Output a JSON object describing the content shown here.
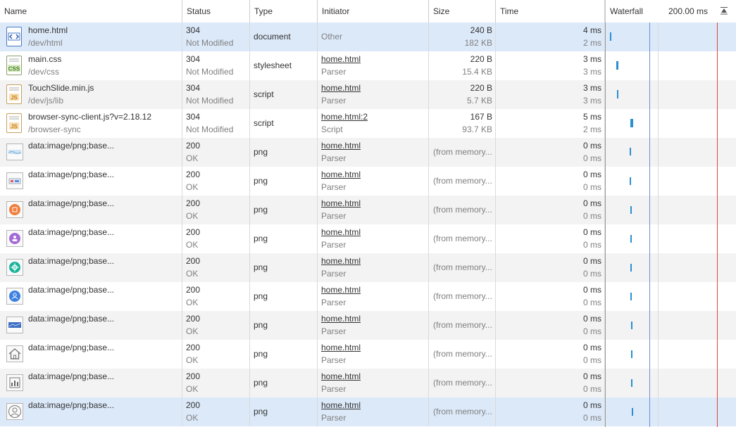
{
  "header": {
    "name": "Name",
    "status": "Status",
    "type": "Type",
    "initiator": "Initiator",
    "size": "Size",
    "time": "Time",
    "waterfall": "Waterfall",
    "waterfall_time": "200.00 ms"
  },
  "colors": {
    "selected_row": "#dce9f9",
    "alt_row": "#f3f3f3",
    "waterfall_bar": "#2a8fd0",
    "dom_content_line": "#6f8ecf",
    "load_line": "#e0443e"
  },
  "rows": [
    {
      "name": "home.html",
      "path": "/dev/html",
      "status": "304",
      "status_text": "Not Modified",
      "type": "document",
      "initiator": "Other",
      "initiator_sub": "",
      "size": "240 B",
      "size2": "182 KB",
      "time": "4 ms",
      "time2": "2 ms",
      "icon": "html-file-icon"
    },
    {
      "name": "main.css",
      "path": "/dev/css",
      "status": "304",
      "status_text": "Not Modified",
      "type": "stylesheet",
      "initiator": "home.html",
      "initiator_sub": "Parser",
      "size": "220 B",
      "size2": "15.4 KB",
      "time": "3 ms",
      "time2": "3 ms",
      "icon": "css-file-icon"
    },
    {
      "name": "TouchSlide.min.js",
      "path": "/dev/js/lib",
      "status": "304",
      "status_text": "Not Modified",
      "type": "script",
      "initiator": "home.html",
      "initiator_sub": "Parser",
      "size": "220 B",
      "size2": "5.7 KB",
      "time": "3 ms",
      "time2": "3 ms",
      "icon": "js-file-icon"
    },
    {
      "name": "browser-sync-client.js?v=2.18.12",
      "path": "/browser-sync",
      "status": "304",
      "status_text": "Not Modified",
      "type": "script",
      "initiator": "home.html:2",
      "initiator_sub": "Script",
      "size": "167 B",
      "size2": "93.7 KB",
      "time": "5 ms",
      "time2": "2 ms",
      "icon": "js-file-icon"
    },
    {
      "name": "data:image/png;base...",
      "path": "",
      "status": "200",
      "status_text": "OK",
      "type": "png",
      "initiator": "home.html",
      "initiator_sub": "Parser",
      "size": "(from memory...",
      "size2": "",
      "time": "0 ms",
      "time2": "0 ms",
      "icon": "banner-image-icon"
    },
    {
      "name": "data:image/png;base...",
      "path": "",
      "status": "200",
      "status_text": "OK",
      "type": "png",
      "initiator": "home.html",
      "initiator_sub": "Parser",
      "size": "(from memory...",
      "size2": "",
      "time": "0 ms",
      "time2": "0 ms",
      "icon": "card-image-icon"
    },
    {
      "name": "data:image/png;base...",
      "path": "",
      "status": "200",
      "status_text": "OK",
      "type": "png",
      "initiator": "home.html",
      "initiator_sub": "Parser",
      "size": "(from memory...",
      "size2": "",
      "time": "0 ms",
      "time2": "0 ms",
      "icon": "orange-circle-icon"
    },
    {
      "name": "data:image/png;base...",
      "path": "",
      "status": "200",
      "status_text": "OK",
      "type": "png",
      "initiator": "home.html",
      "initiator_sub": "Parser",
      "size": "(from memory...",
      "size2": "",
      "time": "0 ms",
      "time2": "0 ms",
      "icon": "purple-circle-icon"
    },
    {
      "name": "data:image/png;base...",
      "path": "",
      "status": "200",
      "status_text": "OK",
      "type": "png",
      "initiator": "home.html",
      "initiator_sub": "Parser",
      "size": "(from memory...",
      "size2": "",
      "time": "0 ms",
      "time2": "0 ms",
      "icon": "teal-circle-icon"
    },
    {
      "name": "data:image/png;base...",
      "path": "",
      "status": "200",
      "status_text": "OK",
      "type": "png",
      "initiator": "home.html",
      "initiator_sub": "Parser",
      "size": "(from memory...",
      "size2": "",
      "time": "0 ms",
      "time2": "0 ms",
      "icon": "blue-user-circle-icon"
    },
    {
      "name": "data:image/png;base...",
      "path": "",
      "status": "200",
      "status_text": "OK",
      "type": "png",
      "initiator": "home.html",
      "initiator_sub": "Parser",
      "size": "(from memory...",
      "size2": "",
      "time": "0 ms",
      "time2": "0 ms",
      "icon": "blue-card-image-icon"
    },
    {
      "name": "data:image/png;base...",
      "path": "",
      "status": "200",
      "status_text": "OK",
      "type": "png",
      "initiator": "home.html",
      "initiator_sub": "Parser",
      "size": "(from memory...",
      "size2": "",
      "time": "0 ms",
      "time2": "0 ms",
      "icon": "home-icon"
    },
    {
      "name": "data:image/png;base...",
      "path": "",
      "status": "200",
      "status_text": "OK",
      "type": "png",
      "initiator": "home.html",
      "initiator_sub": "Parser",
      "size": "(from memory...",
      "size2": "",
      "time": "0 ms",
      "time2": "0 ms",
      "icon": "bar-chart-icon"
    },
    {
      "name": "data:image/png;base...",
      "path": "",
      "status": "200",
      "status_text": "OK",
      "type": "png",
      "initiator": "home.html",
      "initiator_sub": "Parser",
      "size": "(from memory...",
      "size2": "",
      "time": "0 ms",
      "time2": "0 ms",
      "icon": "user-icon"
    }
  ]
}
